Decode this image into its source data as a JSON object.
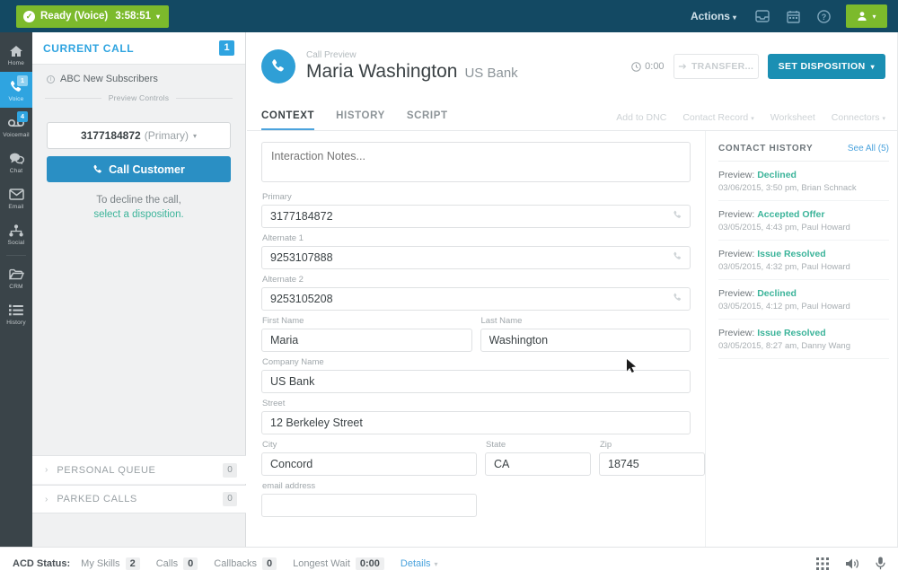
{
  "topbar": {
    "status_text": "Ready (Voice)",
    "status_timer": "3:58:51",
    "status_caret": "▾",
    "status_color": "#7cba2c",
    "bar_color": "#134963",
    "actions_label": "Actions",
    "actions_caret": "▾",
    "icons": [
      "inbox-icon",
      "calendar-icon",
      "help-icon"
    ],
    "user_caret": "▾"
  },
  "rail": {
    "items": [
      {
        "label": "Home",
        "icon": "home-icon",
        "badge": "",
        "active": false
      },
      {
        "label": "Voice",
        "icon": "phone-icon",
        "badge": "1",
        "active": true
      },
      {
        "label": "Voicemail",
        "icon": "voicemail-icon",
        "badge": "4",
        "active": false
      },
      {
        "label": "Chat",
        "icon": "chat-icon",
        "badge": "",
        "active": false
      },
      {
        "label": "Email",
        "icon": "email-icon",
        "badge": "",
        "active": false
      },
      {
        "label": "Social",
        "icon": "social-icon",
        "badge": "",
        "active": false
      },
      {
        "label": "CRM",
        "icon": "crm-folder-icon",
        "badge": "",
        "active": false
      },
      {
        "label": "History",
        "icon": "history-list-icon",
        "badge": "",
        "active": false
      }
    ]
  },
  "left_panel": {
    "title": "CURRENT CALL",
    "count": "1",
    "campaign": "ABC New Subscribers",
    "divider_label": "Preview Controls",
    "phone_number": "3177184872",
    "phone_tag": "(Primary)",
    "phone_caret": "▾",
    "call_button": "Call Customer",
    "decline_line1": "To decline the call,",
    "decline_link": "select a disposition.",
    "queues": [
      {
        "label": "PERSONAL QUEUE",
        "count": "0",
        "arrow": "›"
      },
      {
        "label": "PARKED CALLS",
        "count": "0",
        "arrow": "›"
      }
    ]
  },
  "call_header": {
    "preview_label": "Call Preview",
    "contact_name": "Maria Washington",
    "company": "US Bank",
    "timer": "0:00",
    "transfer_label": "TRANSFER...",
    "disposition_label": "SET DISPOSITION",
    "disposition_caret": "▾"
  },
  "tabs": [
    {
      "label": "CONTEXT",
      "active": true
    },
    {
      "label": "HISTORY",
      "active": false
    },
    {
      "label": "SCRIPT",
      "active": false
    }
  ],
  "tab_links": [
    {
      "label": "Add to DNC",
      "caret": ""
    },
    {
      "label": "Contact Record",
      "caret": "▾"
    },
    {
      "label": "Worksheet",
      "caret": ""
    },
    {
      "label": "Connectors",
      "caret": "▾"
    }
  ],
  "form": {
    "notes_placeholder": "Interaction Notes...",
    "notes_value": "",
    "primary_label": "Primary",
    "primary_value": "3177184872",
    "alt1_label": "Alternate 1",
    "alt1_value": "9253107888",
    "alt2_label": "Alternate 2",
    "alt2_value": "9253105208",
    "first_name_label": "First Name",
    "first_name_value": "Maria",
    "last_name_label": "Last Name",
    "last_name_value": "Washington",
    "company_label": "Company Name",
    "company_value": "US Bank",
    "street_label": "Street",
    "street_value": "12 Berkeley Street",
    "city_label": "City",
    "city_value": "Concord",
    "state_label": "State",
    "state_value": "CA",
    "zip_label": "Zip",
    "zip_value": "18745",
    "email_label": "email address",
    "email_value": ""
  },
  "contact_history": {
    "title": "CONTACT HISTORY",
    "see_all": "See All (5)",
    "prefix": "Preview:",
    "items": [
      {
        "disposition": "Declined",
        "meta": "03/06/2015, 3:50 pm, Brian Schnack"
      },
      {
        "disposition": "Accepted Offer",
        "meta": "03/05/2015, 4:43 pm, Paul Howard"
      },
      {
        "disposition": "Issue Resolved",
        "meta": "03/05/2015, 4:32 pm, Paul Howard"
      },
      {
        "disposition": "Declined",
        "meta": "03/05/2015, 4:12 pm, Paul Howard"
      },
      {
        "disposition": "Issue Resolved",
        "meta": "03/05/2015, 8:27 am, Danny Wang"
      }
    ]
  },
  "bottombar": {
    "acd_label": "ACD Status:",
    "stats": [
      {
        "label": "My Skills",
        "value": "2"
      },
      {
        "label": "Calls",
        "value": "0"
      },
      {
        "label": "Callbacks",
        "value": "0"
      },
      {
        "label": "Longest Wait",
        "value": "0:00"
      }
    ],
    "details_label": "Details",
    "details_caret": "▾",
    "icons": [
      "dialpad-icon",
      "speaker-icon",
      "microphone-icon"
    ]
  }
}
